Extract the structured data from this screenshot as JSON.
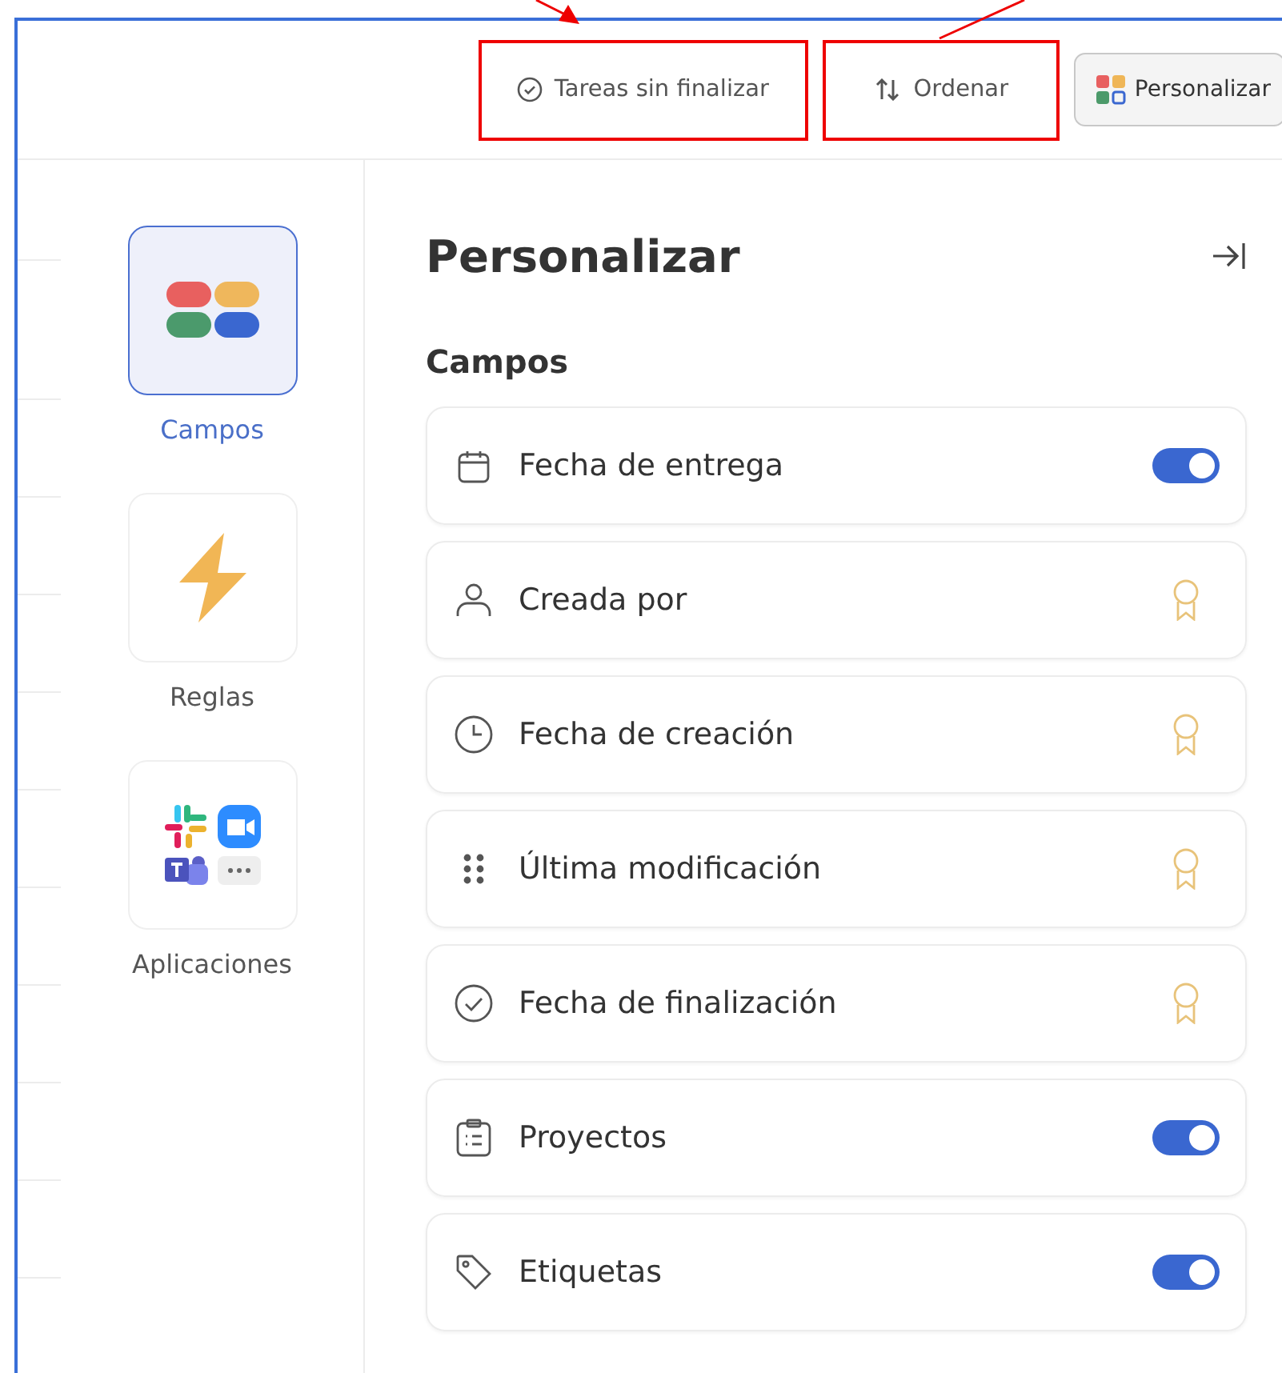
{
  "toolbar": {
    "items": [
      {
        "kind": "filter",
        "label": "Tareas sin finalizar",
        "highlighted": true
      },
      {
        "kind": "sort",
        "label": "Ordenar",
        "highlighted": true
      },
      {
        "kind": "customize",
        "label": "Personalizar",
        "highlighted": false
      }
    ]
  },
  "sidebar": {
    "items": [
      {
        "label": "Campos",
        "selected": true
      },
      {
        "label": "Reglas",
        "selected": false
      },
      {
        "label": "Aplicaciones",
        "selected": false
      }
    ]
  },
  "panel": {
    "title": "Personalizar",
    "section": "Campos",
    "fields": [
      {
        "label": "Fecha de entrega",
        "kind": "toggle",
        "on": true
      },
      {
        "label": "Creada por",
        "kind": "premium"
      },
      {
        "label": "Fecha de creación",
        "kind": "premium"
      },
      {
        "label": "Última modificación",
        "kind": "premium"
      },
      {
        "label": "Fecha de finalización",
        "kind": "premium"
      },
      {
        "label": "Proyectos",
        "kind": "toggle",
        "on": true
      },
      {
        "label": "Etiquetas",
        "kind": "toggle",
        "on": true
      }
    ]
  }
}
